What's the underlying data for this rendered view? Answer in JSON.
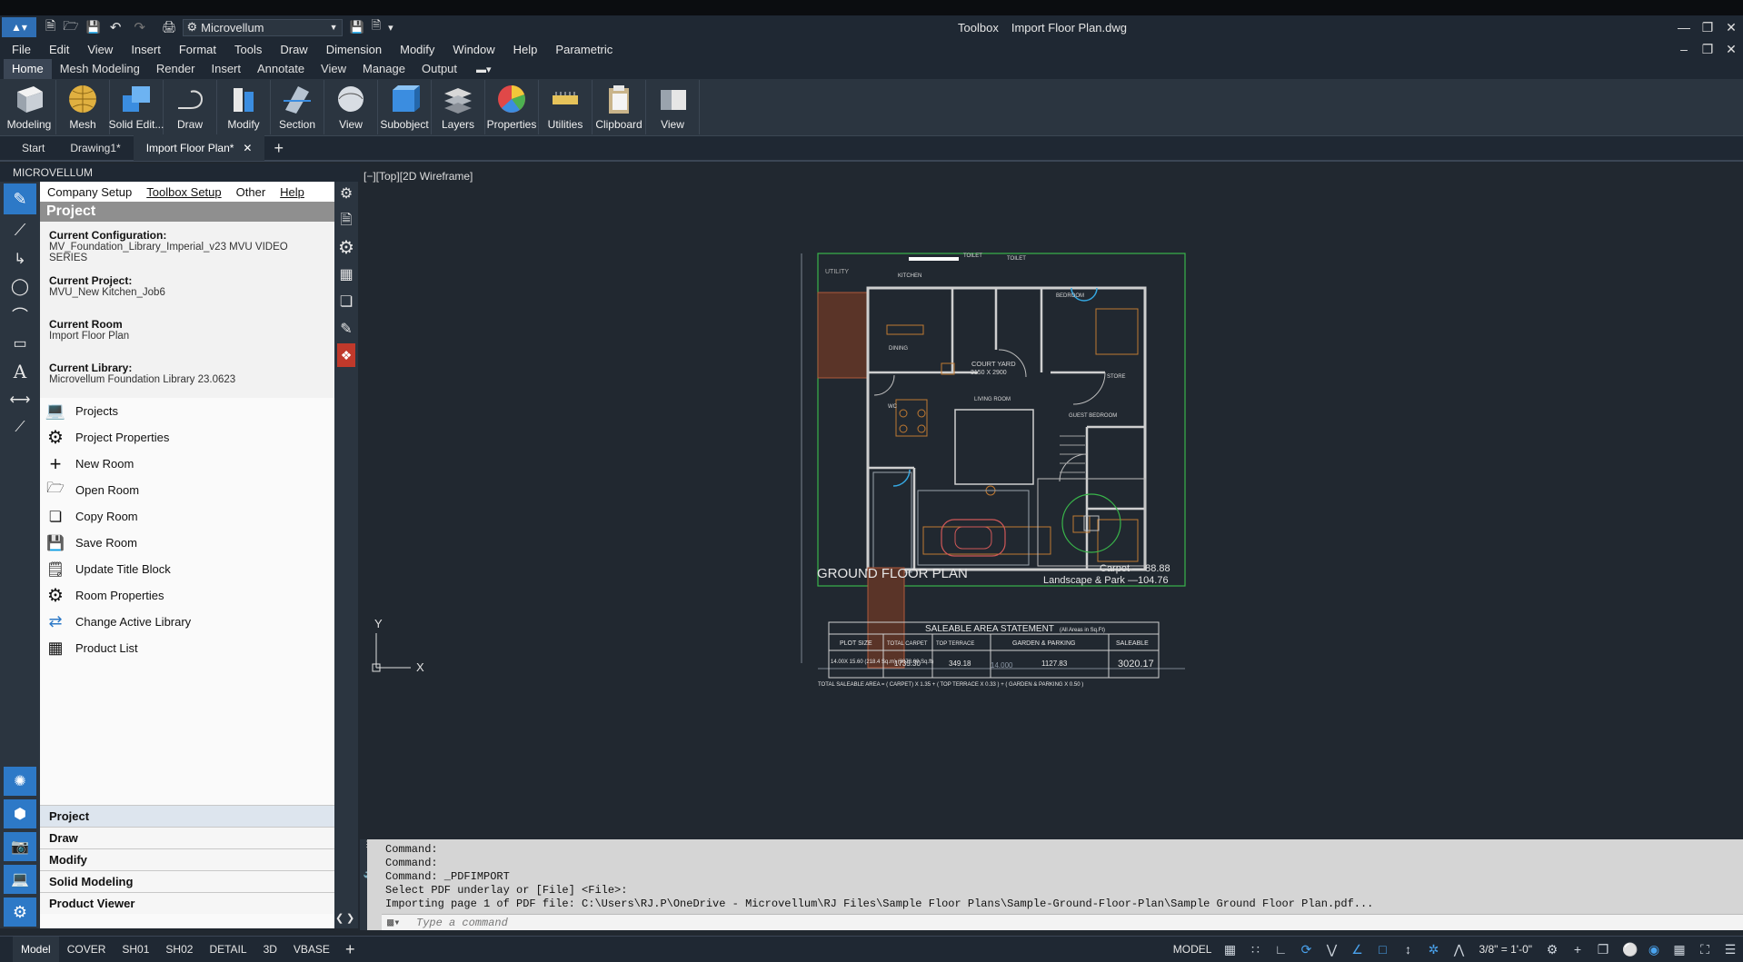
{
  "titlebar": {
    "workspace": "Microvellum",
    "app_title": "Toolbox",
    "file_name": "Import Floor Plan.dwg"
  },
  "menu": [
    "File",
    "Edit",
    "View",
    "Insert",
    "Format",
    "Tools",
    "Draw",
    "Dimension",
    "Modify",
    "Window",
    "Help",
    "Parametric"
  ],
  "ribbon_tabs": [
    "Home",
    "Mesh Modeling",
    "Render",
    "Insert",
    "Annotate",
    "View",
    "Manage",
    "Output"
  ],
  "ribbon_buttons": [
    "Modeling",
    "Mesh",
    "Solid Edit...",
    "Draw",
    "Modify",
    "Section",
    "View",
    "Subobject",
    "Layers",
    "Properties",
    "Utilities",
    "Clipboard",
    "View"
  ],
  "doc_tabs": [
    "Start",
    "Drawing1*",
    "Import Floor Plan*"
  ],
  "palette": {
    "header": "MICROVELLUM",
    "menu": [
      "Company Setup",
      "Toolbox Setup",
      "Other",
      "Help"
    ],
    "section_title": "Project",
    "config_label": "Current Configuration:",
    "config_value": "MV_Foundation_Library_Imperial_v23 MVU VIDEO SERIES",
    "project_label": "Current Project:",
    "project_value": "MVU_New Kitchen_Job6",
    "room_label": "Current Room",
    "room_value": "Import Floor Plan",
    "library_label": "Current Library:",
    "library_value": "Microvellum Foundation Library 23.0623",
    "items": [
      "Projects",
      "Project Properties",
      "New Room",
      "Open Room",
      "Copy Room",
      "Save Room",
      "Update Title Block",
      "Room Properties",
      "Change Active Library",
      "Product List"
    ],
    "footer_tabs": [
      "Project",
      "Draw",
      "Modify",
      "Solid Modeling",
      "Product Viewer"
    ]
  },
  "viewport": {
    "label": "[−][Top][2D Wireframe]",
    "plan": {
      "title": "GROUND FLOOR PLAN",
      "carpet": "Carpet  —  88.88",
      "landscape": "Landscape & Park —104.76",
      "rooms": [
        "KITCHEN",
        "TOILET",
        "TOILET",
        "BEDROOM",
        "UTILITY",
        "DINING",
        "COURT YARD",
        "3150 X 2900",
        "LIVING ROOM",
        "STORE",
        "GUEST BEDROOM",
        "WC"
      ],
      "table_title": "SALEABLE AREA STATEMENT",
      "table_sub": "(All Areas in Sq.Ft)",
      "table_headers": [
        "PLOT SIZE",
        "TOTAL CARPET",
        "TOP TERRACE",
        "GARDEN & PARKING",
        "SALEABLE"
      ],
      "table_values": [
        "14.00X 15.60 (218.4 Sq.m) (3078.00 Sq.ft)",
        "1735.30",
        "349.18",
        "1127.83",
        "3020.17"
      ],
      "table_note": "TOTAL SALEABLE AREA = ( CARPET) X 1.35 + ( TOP TERRACE X 0.33 ) + ( GARDEN & PARKING X 0.50 )",
      "dim_bottom": "14.000"
    }
  },
  "command": {
    "lines": [
      "Command:",
      "Command:",
      "Command: _PDFIMPORT",
      "Select PDF underlay or [File] <File>:",
      "Importing page 1 of PDF file: C:\\Users\\RJ.P\\OneDrive - Microvellum\\RJ Files\\Sample Floor Plans\\Sample-Ground-Floor-Plan\\Sample Ground Floor Plan.pdf..."
    ],
    "placeholder": "Type a command"
  },
  "status": {
    "layout_tabs": [
      "Model",
      "COVER",
      "SH01",
      "SH02",
      "DETAIL",
      "3D",
      "VBASE"
    ],
    "space": "MODEL",
    "scale": "3/8\" = 1'-0\""
  }
}
